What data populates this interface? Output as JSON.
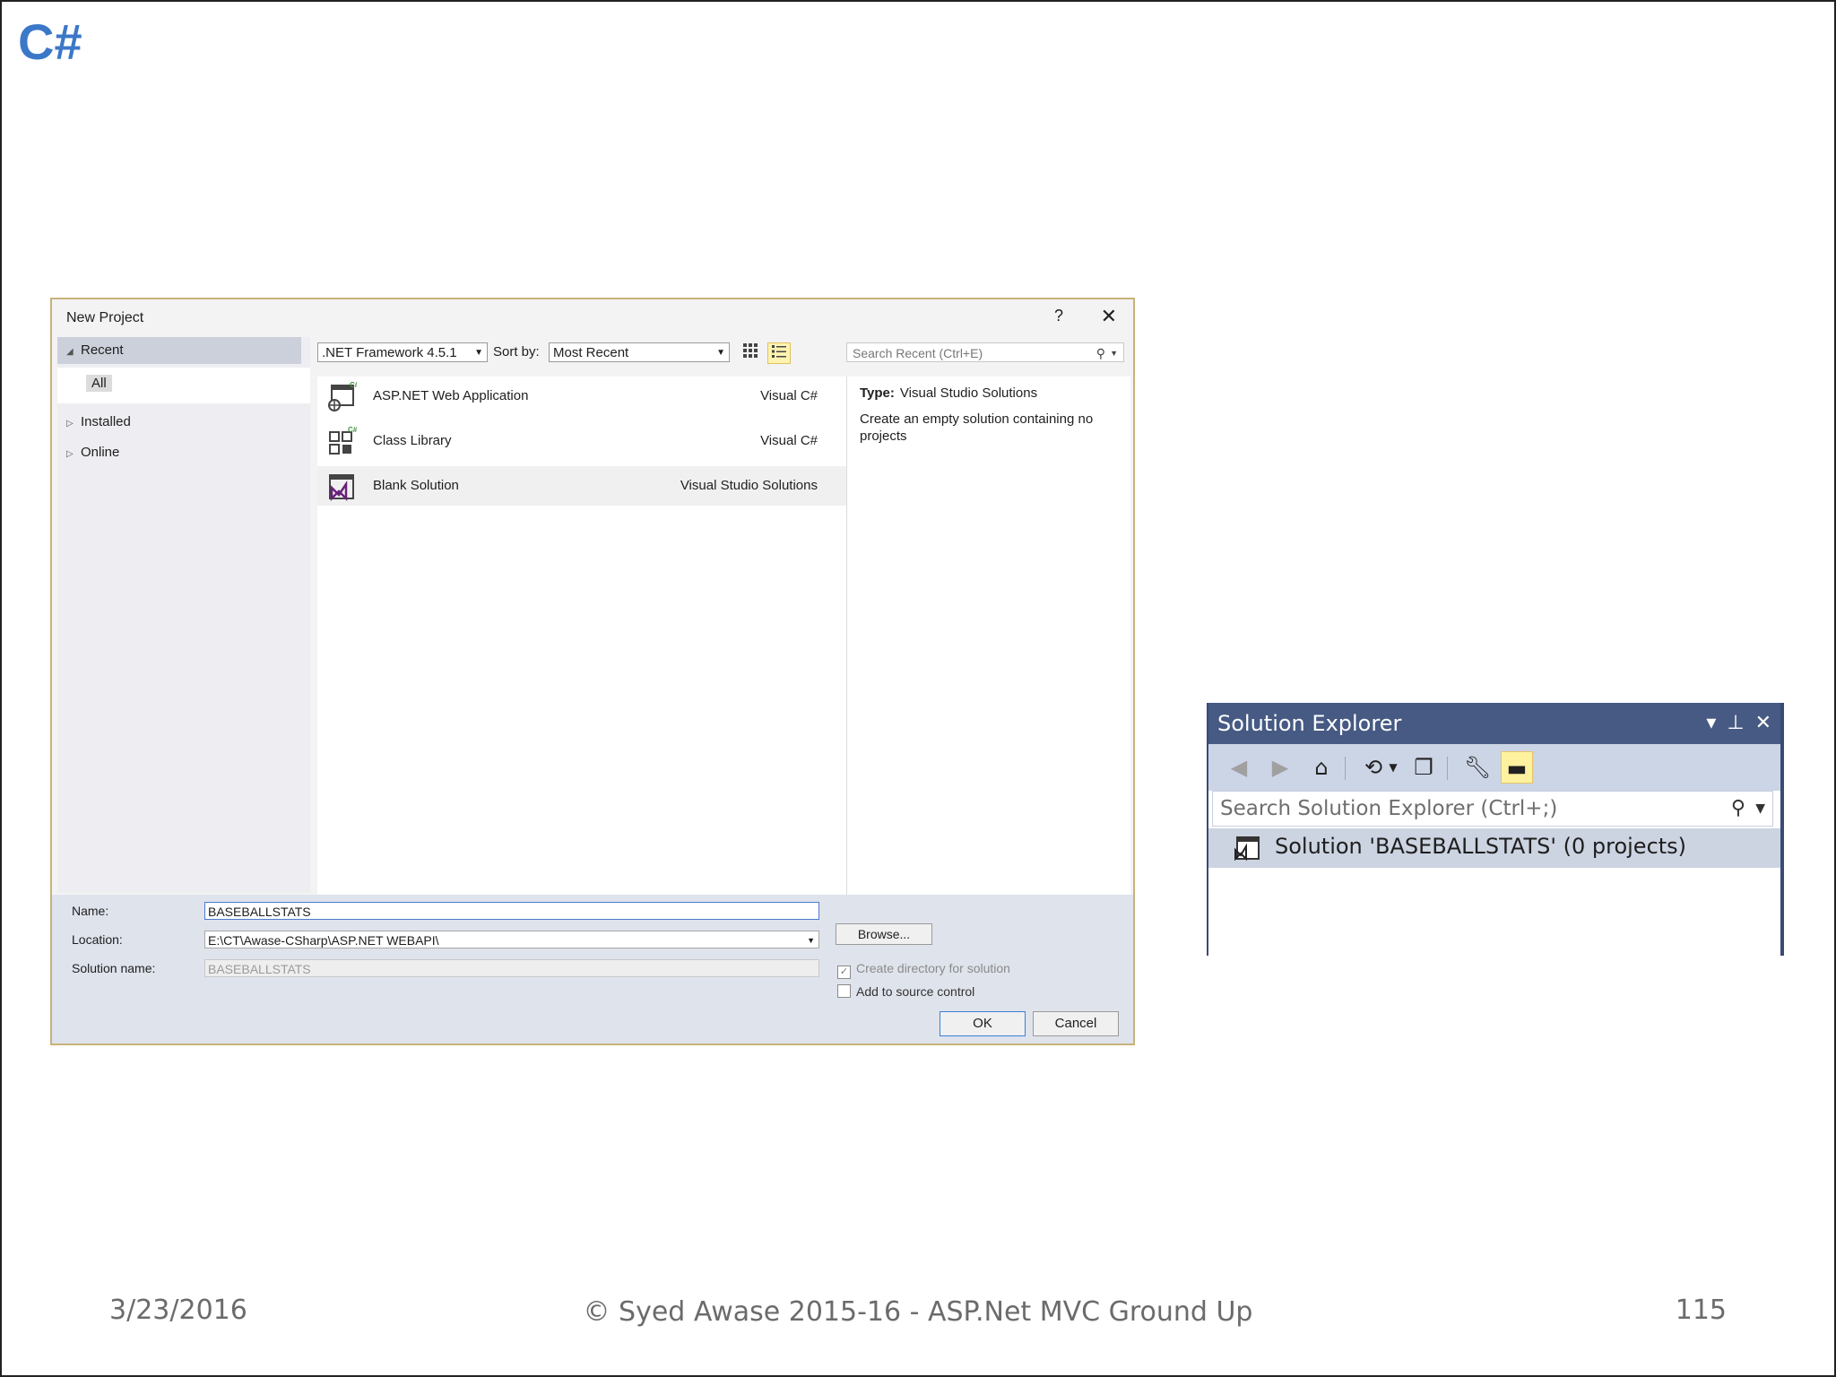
{
  "slide": {
    "title": "C#",
    "footer_date": "3/23/2016",
    "footer_center": "© Syed Awase 2015-16 - ASP.Net MVC Ground Up",
    "page_number": "115"
  },
  "dialog": {
    "title": "New Project",
    "help": "?",
    "close": "✕",
    "tree": {
      "recent": "Recent",
      "all": "All",
      "installed": "Installed",
      "online": "Online"
    },
    "toolbar": {
      "framework": ".NET Framework 4.5.1",
      "sort_label": "Sort by:",
      "sort_value": "Most Recent",
      "search_placeholder": "Search Recent (Ctrl+E)"
    },
    "templates": [
      {
        "name": "ASP.NET Web Application",
        "lang": "Visual C#"
      },
      {
        "name": "Class Library",
        "lang": "Visual C#"
      },
      {
        "name": "Blank Solution",
        "lang": "Visual Studio Solutions"
      }
    ],
    "info": {
      "type_label": "Type:",
      "type_value": "Visual Studio Solutions",
      "description": "Create an empty solution containing no projects"
    },
    "form": {
      "name_label": "Name:",
      "name_value": "BASEBALLSTATS",
      "location_label": "Location:",
      "location_value": "E:\\CT\\Awase-CSharp\\ASP.NET WEBAPI\\",
      "solution_label": "Solution name:",
      "solution_value": "BASEBALLSTATS",
      "browse": "Browse...",
      "create_dir": "Create directory for solution",
      "source_control": "Add to source control",
      "ok": "OK",
      "cancel": "Cancel"
    }
  },
  "solution_explorer": {
    "title": "Solution Explorer",
    "search_placeholder": "Search Solution Explorer (Ctrl+;)",
    "solution_item": "Solution 'BASEBALLSTATS' (0 projects)"
  },
  "colors": {
    "title_blue": "#3b78c8",
    "se_title_bar": "#465a83",
    "se_toolbar": "#ccd5e6",
    "active_toggle": "#fff29e"
  }
}
